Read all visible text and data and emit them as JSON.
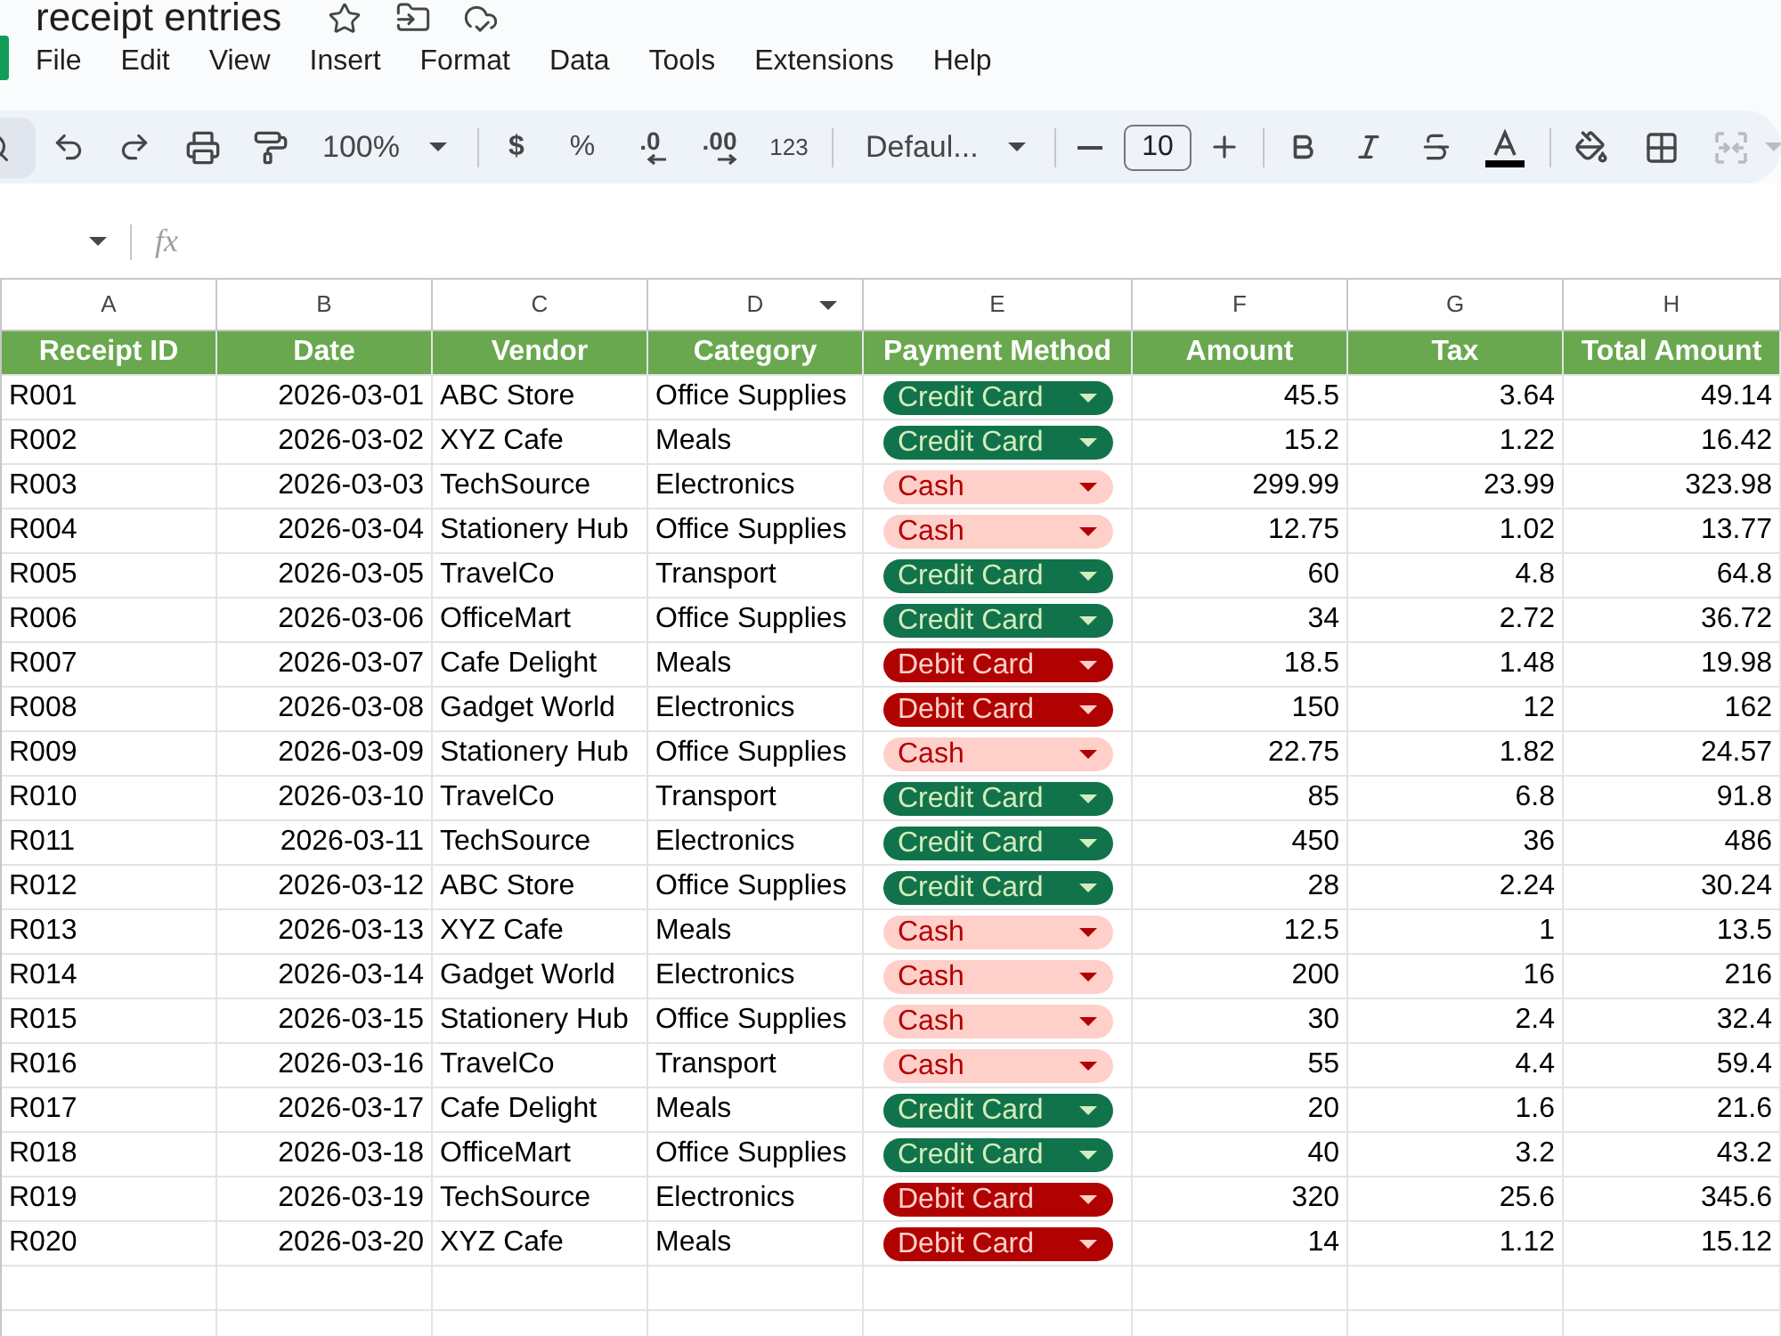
{
  "document": {
    "title": "receipt entries"
  },
  "menu": [
    "File",
    "Edit",
    "View",
    "Insert",
    "Format",
    "Data",
    "Tools",
    "Extensions",
    "Help"
  ],
  "toolbar": {
    "zoom": "100%",
    "currency": "$",
    "percent": "%",
    "decrease_decimals": ".0",
    "increase_decimals": ".00",
    "number_format": "123",
    "font": "Defaul...",
    "font_size": "10"
  },
  "formula_bar": {
    "fx": "fx"
  },
  "sheet": {
    "columns": [
      {
        "label": "A",
        "menu": false
      },
      {
        "label": "B",
        "menu": false
      },
      {
        "label": "C",
        "menu": false
      },
      {
        "label": "D",
        "menu": true
      },
      {
        "label": "E",
        "menu": false
      },
      {
        "label": "F",
        "menu": false
      },
      {
        "label": "G",
        "menu": false
      },
      {
        "label": "H",
        "menu": false
      }
    ],
    "header": [
      "Receipt ID",
      "Date",
      "Vendor",
      "Category",
      "Payment Method",
      "Amount",
      "Tax",
      "Total Amount"
    ],
    "rows": [
      {
        "receipt_id": "R001",
        "date": "2026-03-01",
        "vendor": "ABC Store",
        "category": "Office Supplies",
        "payment_method": {
          "label": "Credit Card",
          "color": "#11734b"
        },
        "amount": "45.5",
        "tax": "3.64",
        "total_amount": "49.14"
      },
      {
        "receipt_id": "R002",
        "date": "2026-03-02",
        "vendor": "XYZ Cafe",
        "category": "Meals",
        "payment_method": {
          "label": "Credit Card",
          "color": "#11734b"
        },
        "amount": "15.2",
        "tax": "1.22",
        "total_amount": "16.42"
      },
      {
        "receipt_id": "R003",
        "date": "2026-03-03",
        "vendor": "TechSource",
        "category": "Electronics",
        "payment_method": {
          "label": "Cash",
          "color": "#ffcfc9"
        },
        "amount": "299.99",
        "tax": "23.99",
        "total_amount": "323.98"
      },
      {
        "receipt_id": "R004",
        "date": "2026-03-04",
        "vendor": "Stationery Hub",
        "category": "Office Supplies",
        "payment_method": {
          "label": "Cash",
          "color": "#ffcfc9"
        },
        "amount": "12.75",
        "tax": "1.02",
        "total_amount": "13.77"
      },
      {
        "receipt_id": "R005",
        "date": "2026-03-05",
        "vendor": "TravelCo",
        "category": "Transport",
        "payment_method": {
          "label": "Credit Card",
          "color": "#11734b"
        },
        "amount": "60",
        "tax": "4.8",
        "total_amount": "64.8"
      },
      {
        "receipt_id": "R006",
        "date": "2026-03-06",
        "vendor": "OfficeMart",
        "category": "Office Supplies",
        "payment_method": {
          "label": "Credit Card",
          "color": "#11734b"
        },
        "amount": "34",
        "tax": "2.72",
        "total_amount": "36.72"
      },
      {
        "receipt_id": "R007",
        "date": "2026-03-07",
        "vendor": "Cafe Delight",
        "category": "Meals",
        "payment_method": {
          "label": "Debit Card",
          "color": "#b10202"
        },
        "amount": "18.5",
        "tax": "1.48",
        "total_amount": "19.98"
      },
      {
        "receipt_id": "R008",
        "date": "2026-03-08",
        "vendor": "Gadget World",
        "category": "Electronics",
        "payment_method": {
          "label": "Debit Card",
          "color": "#b10202"
        },
        "amount": "150",
        "tax": "12",
        "total_amount": "162"
      },
      {
        "receipt_id": "R009",
        "date": "2026-03-09",
        "vendor": "Stationery Hub",
        "category": "Office Supplies",
        "payment_method": {
          "label": "Cash",
          "color": "#ffcfc9"
        },
        "amount": "22.75",
        "tax": "1.82",
        "total_amount": "24.57"
      },
      {
        "receipt_id": "R010",
        "date": "2026-03-10",
        "vendor": "TravelCo",
        "category": "Transport",
        "payment_method": {
          "label": "Credit Card",
          "color": "#11734b"
        },
        "amount": "85",
        "tax": "6.8",
        "total_amount": "91.8"
      },
      {
        "receipt_id": "R011",
        "date": "2026-03-11",
        "vendor": "TechSource",
        "category": "Electronics",
        "payment_method": {
          "label": "Credit Card",
          "color": "#11734b"
        },
        "amount": "450",
        "tax": "36",
        "total_amount": "486"
      },
      {
        "receipt_id": "R012",
        "date": "2026-03-12",
        "vendor": "ABC Store",
        "category": "Office Supplies",
        "payment_method": {
          "label": "Credit Card",
          "color": "#11734b"
        },
        "amount": "28",
        "tax": "2.24",
        "total_amount": "30.24"
      },
      {
        "receipt_id": "R013",
        "date": "2026-03-13",
        "vendor": "XYZ Cafe",
        "category": "Meals",
        "payment_method": {
          "label": "Cash",
          "color": "#ffcfc9"
        },
        "amount": "12.5",
        "tax": "1",
        "total_amount": "13.5"
      },
      {
        "receipt_id": "R014",
        "date": "2026-03-14",
        "vendor": "Gadget World",
        "category": "Electronics",
        "payment_method": {
          "label": "Cash",
          "color": "#ffcfc9"
        },
        "amount": "200",
        "tax": "16",
        "total_amount": "216"
      },
      {
        "receipt_id": "R015",
        "date": "2026-03-15",
        "vendor": "Stationery Hub",
        "category": "Office Supplies",
        "payment_method": {
          "label": "Cash",
          "color": "#ffcfc9"
        },
        "amount": "30",
        "tax": "2.4",
        "total_amount": "32.4"
      },
      {
        "receipt_id": "R016",
        "date": "2026-03-16",
        "vendor": "TravelCo",
        "category": "Transport",
        "payment_method": {
          "label": "Cash",
          "color": "#ffcfc9"
        },
        "amount": "55",
        "tax": "4.4",
        "total_amount": "59.4"
      },
      {
        "receipt_id": "R017",
        "date": "2026-03-17",
        "vendor": "Cafe Delight",
        "category": "Meals",
        "payment_method": {
          "label": "Credit Card",
          "color": "#11734b"
        },
        "amount": "20",
        "tax": "1.6",
        "total_amount": "21.6"
      },
      {
        "receipt_id": "R018",
        "date": "2026-03-18",
        "vendor": "OfficeMart",
        "category": "Office Supplies",
        "payment_method": {
          "label": "Credit Card",
          "color": "#11734b"
        },
        "amount": "40",
        "tax": "3.2",
        "total_amount": "43.2"
      },
      {
        "receipt_id": "R019",
        "date": "2026-03-19",
        "vendor": "TechSource",
        "category": "Electronics",
        "payment_method": {
          "label": "Debit Card",
          "color": "#b10202"
        },
        "amount": "320",
        "tax": "25.6",
        "total_amount": "345.6"
      },
      {
        "receipt_id": "R020",
        "date": "2026-03-20",
        "vendor": "XYZ Cafe",
        "category": "Meals",
        "payment_method": {
          "label": "Debit Card",
          "color": "#b10202"
        },
        "amount": "14",
        "tax": "1.12",
        "total_amount": "15.12"
      }
    ]
  }
}
